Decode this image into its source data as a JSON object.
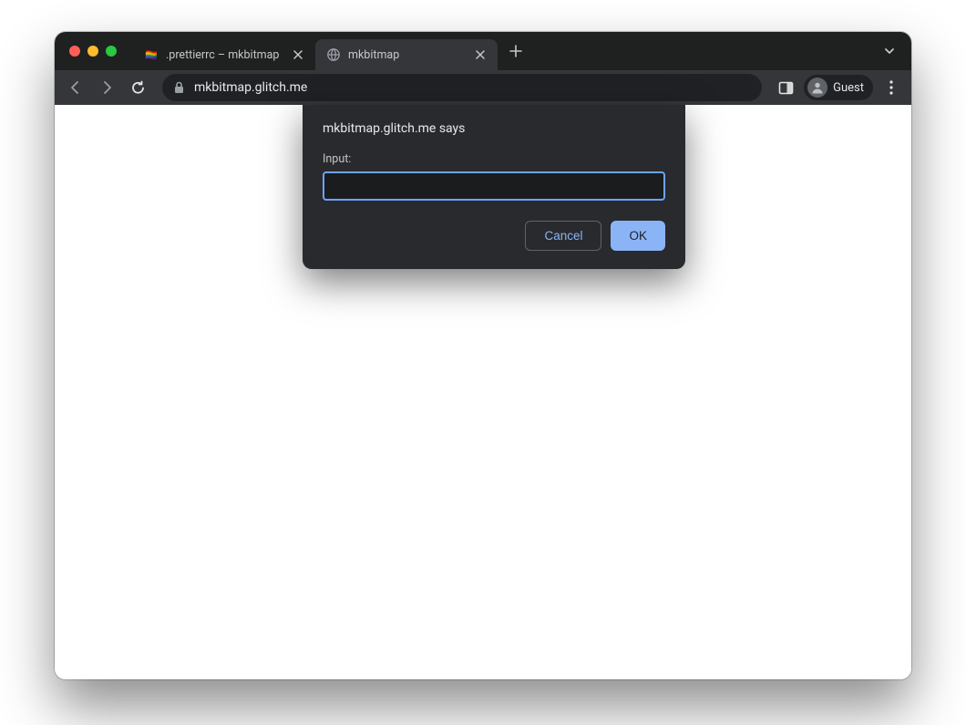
{
  "tabs": [
    {
      "title": ".prettierrc – mkbitmap"
    },
    {
      "title": "mkbitmap"
    }
  ],
  "url": "mkbitmap.glitch.me",
  "profile": {
    "label": "Guest"
  },
  "dialog": {
    "host_says": "mkbitmap.glitch.me says",
    "label": "Input:",
    "value": "",
    "cancel_label": "Cancel",
    "ok_label": "OK"
  }
}
